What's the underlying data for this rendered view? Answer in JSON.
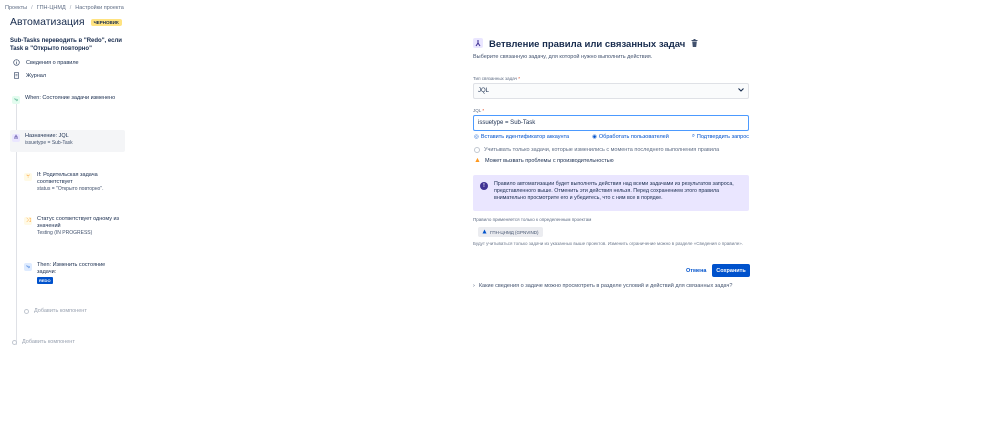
{
  "breadcrumbs": [
    "Проекты",
    "ГПН-ЦНМД",
    "Настройки проекта"
  ],
  "header": {
    "title": "Автоматизация",
    "badge": "ЧЕРНОВИК"
  },
  "sidebar": {
    "rule_name": "Sub-Tasks переводить в \"Redo\", если Task в \"Открыто повторно\"",
    "items": [
      {
        "label": "Сведения о правиле",
        "icon": "info-icon"
      },
      {
        "label": "Журнал",
        "icon": "journal-icon"
      }
    ],
    "steps": {
      "when": {
        "title": "When: Состояние задачи изменено"
      },
      "branch": {
        "title": "Назначение: JQL",
        "sub": "issuetype = Sub-Task"
      },
      "if": {
        "title": "If: Родительская задача соответствует",
        "sub": "status = \"Открыто повторно\"."
      },
      "status": {
        "title": "Статус соответствует одному из значений",
        "sub": "Testing (IN PROGRESS)"
      },
      "then": {
        "title": "Then: Изменить состояние задачи:",
        "tag": "REDO"
      }
    },
    "add_inner": "Добавить компонент",
    "add_outer": "Добавить компонент"
  },
  "panel": {
    "title": "Ветвление правила или связанных задач",
    "description": "Выберите связанную задачу, для которой нужно выполнить действия.",
    "type_label": "Тип связанных задач",
    "type_value": "JQL",
    "jql_label": "JQL",
    "jql_value": "issuetype = Sub-Task",
    "link_insert": "Вставить идентификатор аккаунта",
    "link_process": "Обработать пользователей",
    "link_validate": "Подтвердить запрос",
    "checkbox_label": "Учитывать только задачи, которые изменились с момента последнего выполнения правила",
    "warning": "Может вызвать проблемы с производительностью",
    "info": "Правило автоматизации будет выполнять действия над всеми задачами из результатов запроса, представленного выше. Отменить эти действия нельзя. Перед сохранением этого правила внимательно просмотрите его и убедитесь, что с ним все в порядке.",
    "scope_label": "Правило применяется только к определенным проектам",
    "scope_project": "ГПН-ЦНМД (GPNVIND)",
    "scope_note": "Будут учитываться только задачи из указанных выше проектов. Изменить ограничение можно в разделе «Сведения о правиле».",
    "cancel": "Отмена",
    "save": "Сохранить",
    "help": "Какие сведения о задаче можно просмотреть в разделе условий и действий для связанных задач?"
  },
  "colors": {
    "primary": "#0052cc",
    "info_bg": "#eae6ff",
    "badge": "#ffe380",
    "warning": "#ff991f"
  }
}
